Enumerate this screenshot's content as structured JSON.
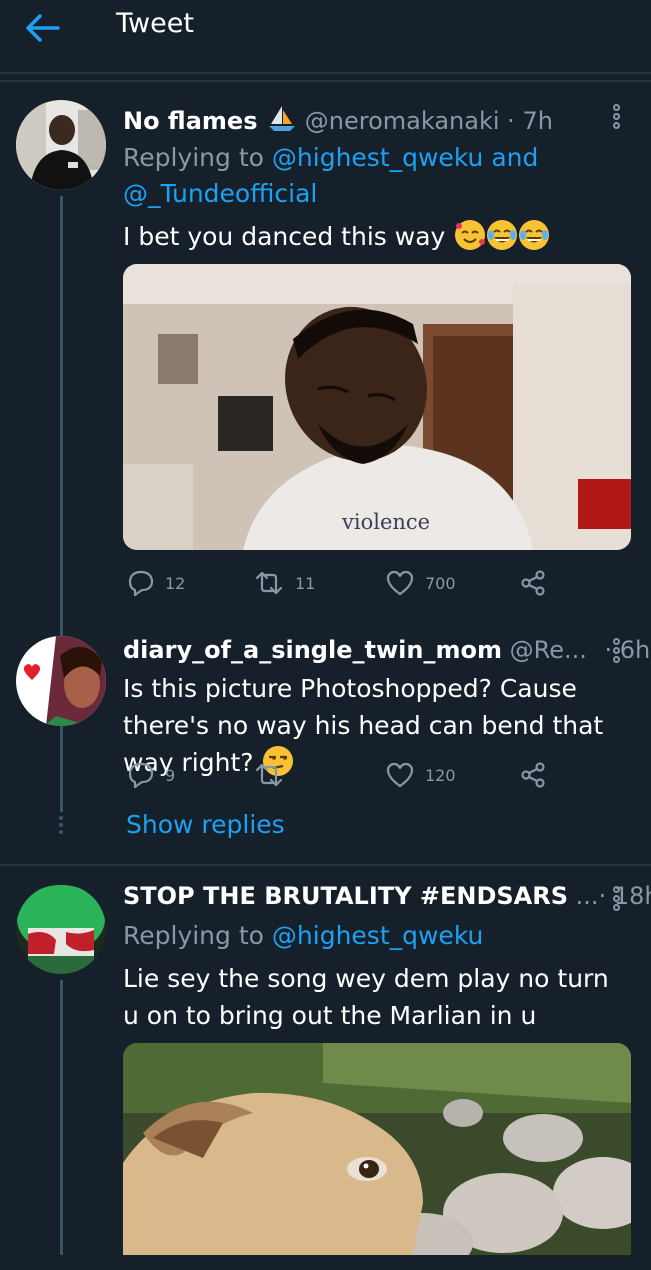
{
  "header": {
    "title": "Tweet"
  },
  "tweets": [
    {
      "name": "No flames",
      "handle": "@neromakanaki",
      "separator": "·",
      "time": "7h",
      "reply_prefix": "Replying to",
      "reply_user1": "@highest_qweku",
      "reply_and": "and",
      "reply_user2": "@_Tundeofficial",
      "text": "I bet you danced this way",
      "emojis": [
        "smiling-face-with-hearts",
        "face-with-tears-of-joy",
        "face-with-tears-of-joy"
      ],
      "media_caption": "violence",
      "replies": "12",
      "retweets": "11",
      "likes": "700"
    },
    {
      "name": "diary_of_a_single_twin_mom",
      "handle": "@Re...",
      "separator": "·",
      "time": "6h",
      "text": "Is this picture Photoshopped? Cause there's no way his head can bend that way right?",
      "emojis": [
        "unamused-face"
      ],
      "replies": "9",
      "retweets": "",
      "likes": "120",
      "show_replies": "Show replies"
    },
    {
      "name": "STOP THE BRUTALITY #ENDSARS",
      "handle": "...",
      "separator": "·",
      "time": "18h",
      "reply_prefix": "Replying to",
      "reply_user1": "@highest_qweku",
      "text": "Lie sey the song wey dem play no turn u on to bring out the Marlian in u"
    }
  ],
  "colors": {
    "background": "#15202b",
    "accent": "#1da1f2",
    "muted": "#8899a6",
    "divider": "#243447"
  }
}
